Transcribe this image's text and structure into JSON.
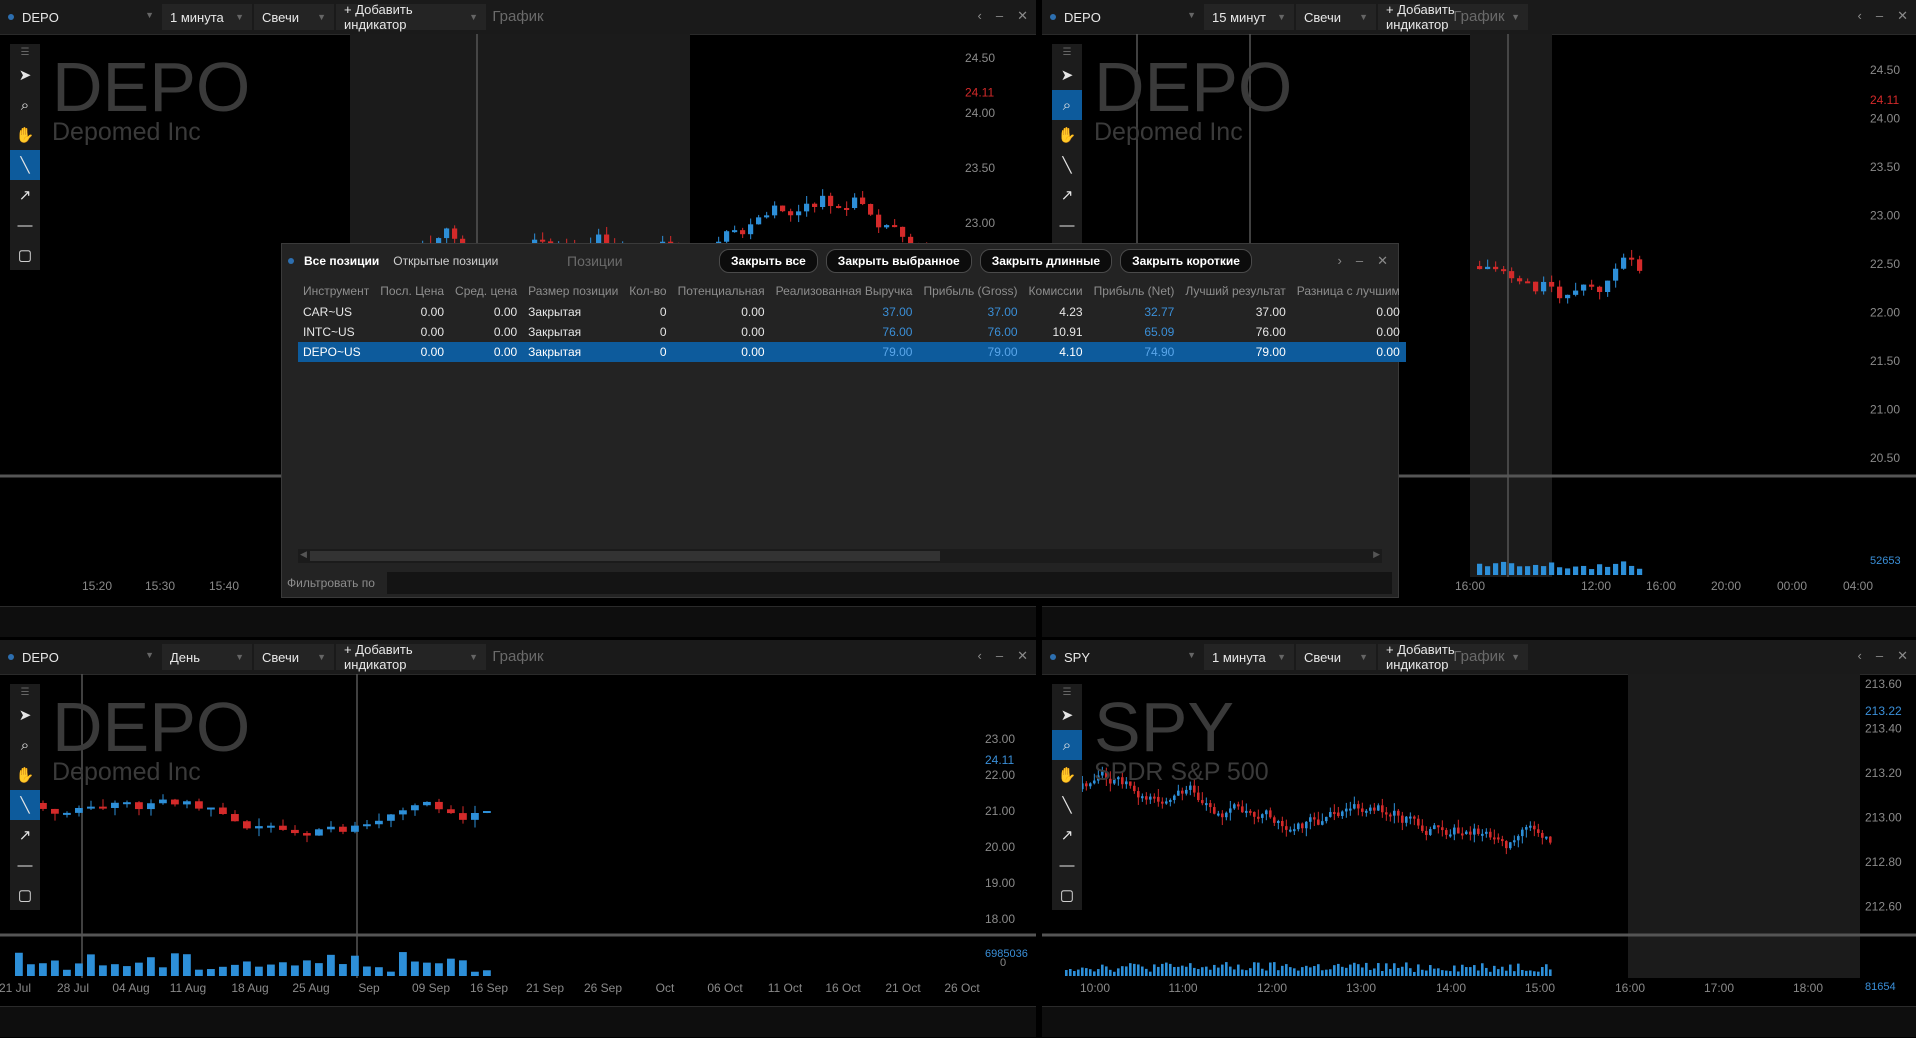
{
  "panels": [
    {
      "symbol": "DEPO",
      "timeframe": "1 минута",
      "style": "Свечи",
      "add_indicator": "+ Добавить индикатор",
      "title": "График",
      "watermark": "DEPO",
      "company": "Depomed Inc",
      "price_labels": [
        "24.50",
        "24.00",
        "23.50",
        "23.00"
      ],
      "last_price": "24.11",
      "time_labels": [
        "15:20",
        "15:30",
        "15:40"
      ]
    },
    {
      "symbol": "DEPO",
      "timeframe": "15 минут",
      "style": "Свечи",
      "add_indicator": "+ Добавить индикатор",
      "title": "График",
      "watermark": "DEPO",
      "company": "Depomed Inc",
      "price_labels": [
        "24.50",
        "24.00",
        "23.50",
        "23.00",
        "22.50",
        "22.00",
        "21.50",
        "21.00",
        "20.50"
      ],
      "last_price": "24.11",
      "volume_label": "52653",
      "time_labels": [
        "16:00",
        "12:00",
        "16:00",
        "20:00",
        "00:00",
        "04:00"
      ]
    },
    {
      "symbol": "DEPO",
      "timeframe": "День",
      "style": "Свечи",
      "add_indicator": "+ Добавить индикатор",
      "title": "График",
      "watermark": "DEPO",
      "company": "Depomed Inc",
      "price_labels": [
        "23.00",
        "22.00",
        "21.00",
        "20.00",
        "19.00",
        "18.00"
      ],
      "last_price": "24.11",
      "volume_label": "6985036",
      "volume_zero": "0",
      "time_labels": [
        "21 Jul",
        "28 Jul",
        "04 Aug",
        "11 Aug",
        "18 Aug",
        "25 Aug",
        "Sep",
        "09 Sep",
        "16 Sep",
        "21 Sep",
        "26 Sep",
        "Oct",
        "06 Oct",
        "11 Oct",
        "16 Oct",
        "21 Oct",
        "26 Oct"
      ]
    },
    {
      "symbol": "SPY",
      "timeframe": "1 минута",
      "style": "Свечи",
      "add_indicator": "+ Добавить индикатор",
      "title": "График",
      "watermark": "SPY",
      "company": "SPDR S&P 500",
      "price_labels": [
        "213.60",
        "213.40",
        "213.20",
        "213.00",
        "212.80",
        "212.60"
      ],
      "last_price": "213.22",
      "volume_label": "81654",
      "time_labels": [
        "10:00",
        "11:00",
        "12:00",
        "13:00",
        "14:00",
        "15:00",
        "16:00",
        "17:00",
        "18:00"
      ]
    }
  ],
  "positions": {
    "tabs": [
      "Все позиции",
      "Открытые позиции"
    ],
    "title": "Позиции",
    "buttons": [
      "Закрыть все",
      "Закрыть выбранное",
      "Закрыть длинные",
      "Закрыть короткие"
    ],
    "columns": [
      "Инструмент",
      "Посл. Цена",
      "Сред. цена",
      "Размер позиции",
      "Кол-во",
      "Потенциальная",
      "Реализованная Выручка",
      "Прибыль (Gross)",
      "Комиссии",
      "Прибыль (Net)",
      "Лучший результат",
      "Разница с лучшим"
    ],
    "rows": [
      [
        "CAR~US",
        "0.00",
        "0.00",
        "Закрытая",
        "0",
        "0.00",
        "37.00",
        "37.00",
        "4.23",
        "32.77",
        "37.00",
        "0.00"
      ],
      [
        "INTC~US",
        "0.00",
        "0.00",
        "Закрытая",
        "0",
        "0.00",
        "76.00",
        "76.00",
        "10.91",
        "65.09",
        "76.00",
        "0.00"
      ],
      [
        "DEPO~US",
        "0.00",
        "0.00",
        "Закрытая",
        "0",
        "0.00",
        "79.00",
        "79.00",
        "4.10",
        "74.90",
        "79.00",
        "0.00"
      ]
    ],
    "selected_row": 2,
    "filter_label": "Фильтровать по"
  },
  "colors": {
    "up": "#2d8fd8",
    "down": "#d42a2a",
    "accent": "#0d5b9c"
  }
}
